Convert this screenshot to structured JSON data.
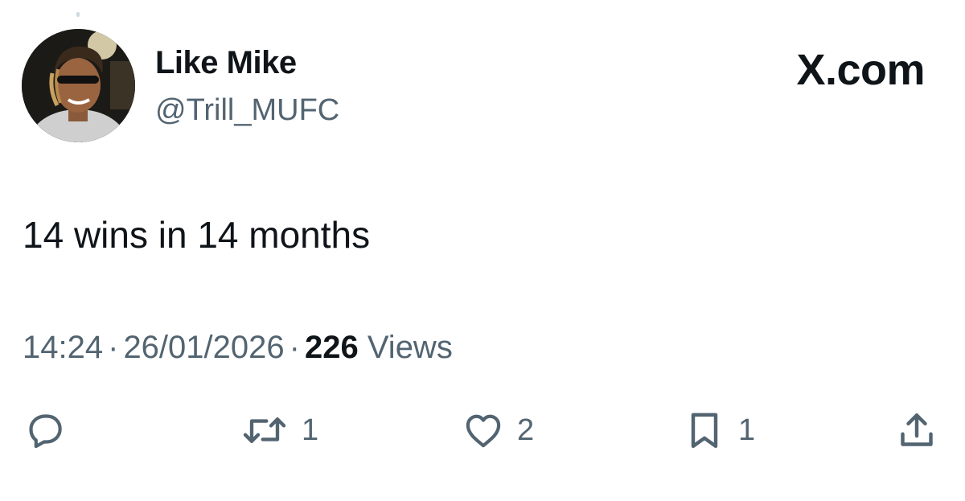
{
  "author": {
    "display_name": "Like Mike",
    "handle": "@Trill_MUFC"
  },
  "brand": "X.com",
  "tweet": {
    "text": "14 wins in 14 months"
  },
  "meta": {
    "time": "14:24",
    "date": "26/01/2026",
    "views_count": "226",
    "views_label": "Views",
    "separator": "·"
  },
  "actions": {
    "reply_icon": "reply-icon",
    "retweet_icon": "retweet-icon",
    "retweet_count": "1",
    "like_icon": "heart-icon",
    "like_count": "2",
    "bookmark_icon": "bookmark-icon",
    "bookmark_count": "1",
    "share_icon": "share-icon"
  },
  "colors": {
    "text_primary": "#0f1419",
    "text_secondary": "#536471",
    "background": "#ffffff"
  }
}
